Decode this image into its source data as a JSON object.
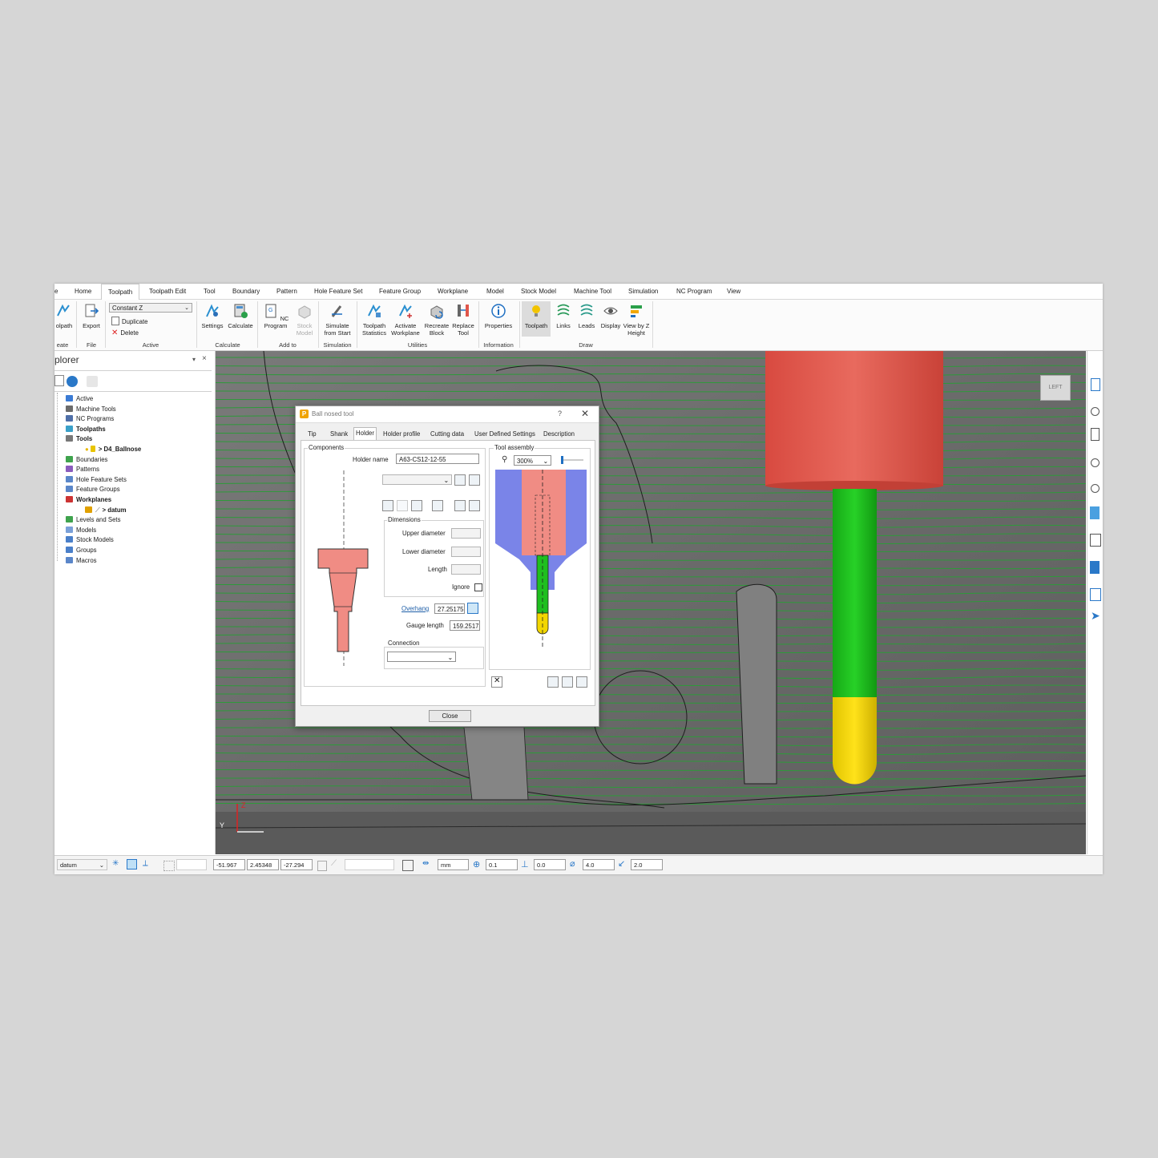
{
  "tabs": [
    "e",
    "Home",
    "Toolpath",
    "Toolpath Edit",
    "Tool",
    "Boundary",
    "Pattern",
    "Hole Feature Set",
    "Feature Group",
    "Workplane",
    "Model",
    "Stock Model",
    "Machine Tool",
    "Simulation",
    "NC Program",
    "View"
  ],
  "active_tab": "Toolpath",
  "ribbon": {
    "create_label": "olpath",
    "create_group": "eate",
    "export_label": "Export",
    "file_group": "File",
    "active_combo": "Constant Z",
    "duplicate_label": "Duplicate",
    "delete_label": "Delete",
    "active_group": "Active",
    "settings_label": "Settings",
    "calculate_label": "Calculate",
    "calculate_group": "Calculate",
    "nc_program_label": "NC Program",
    "stock_model_label": "Stock Model",
    "add_to_group": "Add to",
    "simulate_label": "Simulate from Start",
    "simulation_group": "Simulation",
    "toolpath_statistics_label": "Toolpath Statistics",
    "activate_workplane_label": "Activate Workplane",
    "recreate_block_label": "Recreate Block",
    "replace_tool_label": "Replace Tool",
    "utilities_group": "Utilities",
    "properties_label": "Properties",
    "information_group": "Information",
    "toolpath_label": "Toolpath",
    "links_label": "Links",
    "leads_label": "Leads",
    "display_label": "Display",
    "view_by_z_label": "View by Z Height",
    "draw_group": "Draw"
  },
  "explorer": {
    "title": "plorer",
    "items": [
      {
        "label": "Active",
        "bold": false,
        "color": "#3b7bd4"
      },
      {
        "label": "Machine Tools",
        "bold": false,
        "color": "#6b6b6b"
      },
      {
        "label": "NC Programs",
        "bold": false,
        "color": "#4f6fa8"
      },
      {
        "label": "Toolpaths",
        "bold": true,
        "color": "#3aa0c8"
      },
      {
        "label": "Tools",
        "bold": true,
        "color": "#777777"
      },
      {
        "label": "> D4_Ballnose",
        "bold": true,
        "color": "#e8c400"
      },
      {
        "label": "Boundaries",
        "bold": false,
        "color": "#3fa34d"
      },
      {
        "label": "Patterns",
        "bold": false,
        "color": "#8a5bbd"
      },
      {
        "label": "Hole Feature Sets",
        "bold": false,
        "color": "#5a86c9"
      },
      {
        "label": "Feature Groups",
        "bold": false,
        "color": "#5a86c9"
      },
      {
        "label": "Workplanes",
        "bold": true,
        "color": "#cc3333"
      },
      {
        "label": "> datum",
        "bold": true,
        "color": "#e0a000"
      },
      {
        "label": "Levels and Sets",
        "bold": false,
        "color": "#3fa34d"
      },
      {
        "label": "Models",
        "bold": false,
        "color": "#7aa0d8"
      },
      {
        "label": "Stock Models",
        "bold": false,
        "color": "#4a7fc9"
      },
      {
        "label": "Groups",
        "bold": false,
        "color": "#4a7fc9"
      },
      {
        "label": "Macros",
        "bold": false,
        "color": "#5a86c9"
      }
    ]
  },
  "viewport": {
    "view_cube_label": "LEFT",
    "axis_y": "Y",
    "axis_z": "Z"
  },
  "dialog": {
    "title": "Ball nosed tool",
    "help": "?",
    "tabs": [
      "Tip",
      "Shank",
      "Holder",
      "Holder profile",
      "Cutting data",
      "User Defined Settings",
      "Description"
    ],
    "active_tab": "Holder",
    "components_label": "Components",
    "holder_name_label": "Holder name",
    "holder_name_value": "A63-CS12-12-55",
    "dimensions_label": "Dimensions",
    "upper_diameter_label": "Upper diameter",
    "lower_diameter_label": "Lower diameter",
    "length_label": "Length",
    "ignore_label": "Ignore",
    "overhang_label": "Overhang",
    "overhang_value": "27.25175",
    "gauge_length_label": "Gauge length",
    "gauge_length_value": "159.2517",
    "connection_label": "Connection",
    "tool_assembly_label": "Tool assembly",
    "zoom_value": "300%",
    "close_label": "Close"
  },
  "status": {
    "workplane": "datum",
    "x": "-51.967",
    "y": "2.45348",
    "z": "-27.294",
    "units": "mm",
    "tolerance": "0.1",
    "thickness": "0.0",
    "diameter": "4.0",
    "stepover": "2.0"
  },
  "colors": {
    "holder": "#e0564a",
    "shank": "#1fbf1f",
    "tip": "#f2d600",
    "toolpath": "#2e9a3a",
    "holder_profile": "#7a84e8"
  }
}
